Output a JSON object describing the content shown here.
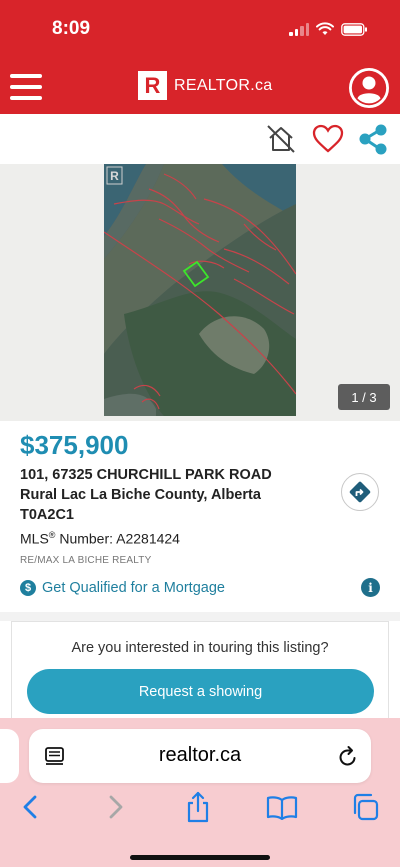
{
  "status_bar": {
    "time": "8:09"
  },
  "header": {
    "brand": "REALTOR.ca",
    "logo_letter": "R"
  },
  "photo": {
    "counter": "1 / 3"
  },
  "listing": {
    "price": "$375,900",
    "address_line1": "101, 67325 CHURCHILL PARK ROAD",
    "address_line2": "Rural Lac La Biche County, Alberta",
    "postal_code": "T0A2C1",
    "mls_label": "MLS",
    "mls_reg": "®",
    "mls_number_text": " Number: A2281424",
    "brokerage": "RE/MAX LA BICHE REALTY",
    "mortgage_link": "Get Qualified for a Mortgage"
  },
  "tour": {
    "question": "Are you interested in touring this listing?",
    "button_label": "Request a showing"
  },
  "browser": {
    "url": "realtor.ca"
  },
  "colors": {
    "brand_red": "#d8242a",
    "price_blue": "#1f8db2",
    "button_teal": "#2aa1c0",
    "safari_bar": "#f7ccd0"
  },
  "icons": [
    "hamburger-icon",
    "profile-icon",
    "remove-listing-icon",
    "heart-icon",
    "share-icon",
    "directions-icon",
    "dollar-icon",
    "info-icon",
    "reader-icon",
    "reload-icon",
    "back-icon",
    "forward-icon",
    "share-sheet-icon",
    "bookmarks-icon",
    "tabs-icon"
  ]
}
